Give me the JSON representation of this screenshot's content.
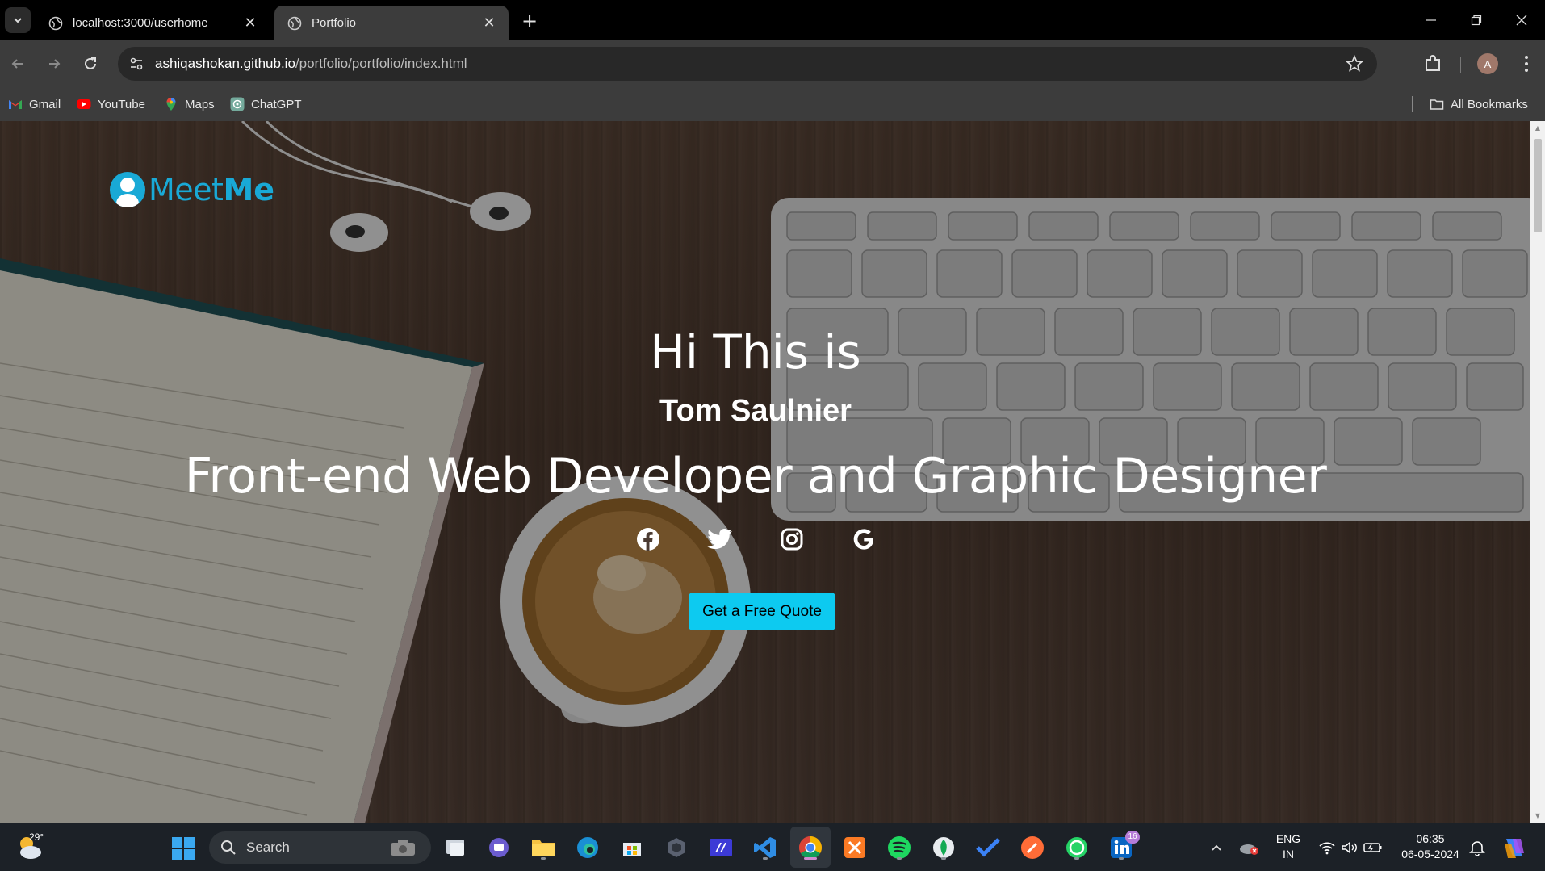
{
  "browser": {
    "tabs": [
      {
        "title": "localhost:3000/userhome",
        "active": false
      },
      {
        "title": "Portfolio",
        "active": true
      }
    ],
    "url_host": "ashiqashokan.github.io",
    "url_path": "/portfolio/portfolio/index.html",
    "profile_initial": "A",
    "bookmarks": [
      {
        "label": "Gmail",
        "icon": "gmail-icon"
      },
      {
        "label": "YouTube",
        "icon": "youtube-icon"
      },
      {
        "label": "Maps",
        "icon": "maps-icon"
      },
      {
        "label": "ChatGPT",
        "icon": "chatgpt-icon"
      }
    ],
    "all_bookmarks_label": "All Bookmarks"
  },
  "page": {
    "brand_light": "Meet",
    "brand_bold": "Me",
    "hero_greeting": "Hi This is",
    "hero_name": "Tom Saulnier",
    "hero_role": "Front-end Web Developer and Graphic Designer",
    "socials": [
      "facebook-icon",
      "twitter-icon",
      "instagram-icon",
      "google-icon"
    ],
    "cta_label": "Get a Free Quote",
    "accent_color": "#0dcaf0",
    "brand_color": "#19a9d6"
  },
  "taskbar": {
    "weather_temp": "29°",
    "search_label": "Search",
    "lang_line1": "ENG",
    "lang_line2": "IN",
    "time": "06:35",
    "date": "06-05-2024",
    "linkedin_badge": "16"
  }
}
